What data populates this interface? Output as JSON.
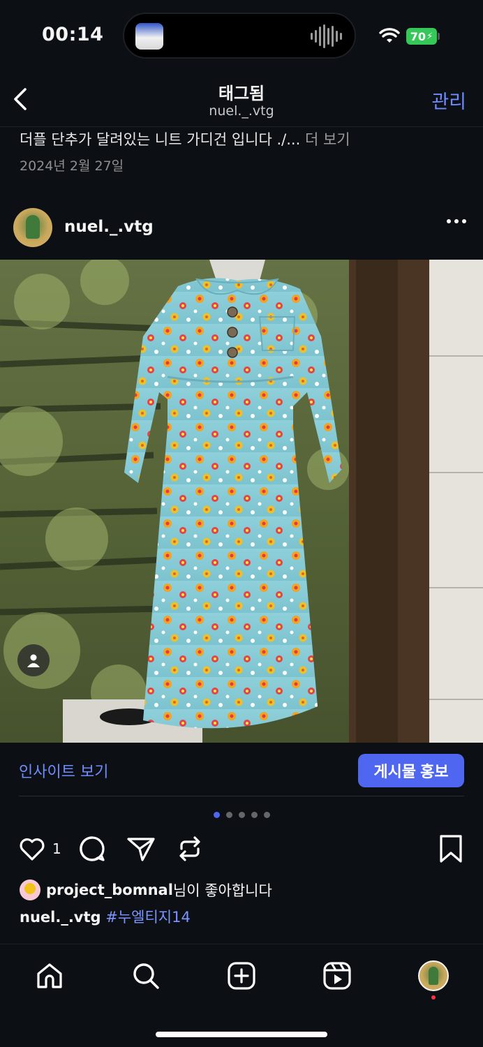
{
  "status_bar": {
    "time": "00:14",
    "battery": "70"
  },
  "header": {
    "title": "태그됨",
    "subtitle": "nuel._.vtg",
    "manage_label": "관리"
  },
  "previous_post": {
    "caption": "더플 단추가 달려있는 니트 가디건 입니다 ./...",
    "more_label": "더 보기",
    "date": "2024년 2월 27일"
  },
  "post": {
    "username": "nuel._.vtg",
    "insights_label": "인사이트 보기",
    "promote_label": "게시물 홍보",
    "carousel": {
      "count": 5,
      "active_index": 0
    },
    "like_count": "1",
    "liker": "project_bomnal",
    "liked_suffix": "님이 좋아합니다",
    "caption_user": "nuel._.vtg",
    "hashtag": "#누엘티지14"
  },
  "tabbar": {
    "items": [
      "home-icon",
      "search-icon",
      "create-icon",
      "reels-icon",
      "profile-avatar"
    ]
  },
  "colors": {
    "background": "#0c1014",
    "accent": "#4f67f0",
    "link": "#6f8cff",
    "battery": "#36c759",
    "notification": "#ff3040"
  }
}
